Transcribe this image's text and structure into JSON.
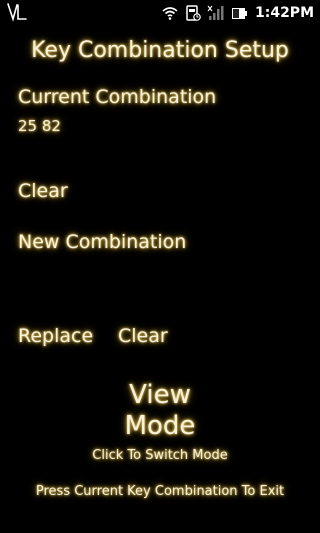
{
  "statusbar": {
    "app_icon": "vl-logo-icon",
    "icons": [
      "wifi-icon",
      "battery-saver-icon",
      "signal-icon",
      "battery-icon"
    ],
    "time": "1:42PM"
  },
  "screen": {
    "title": "Key Combination Setup",
    "current": {
      "label": "Current Combination",
      "value": "25 82",
      "clear_label": "Clear"
    },
    "new": {
      "label": "New Combination",
      "value": "",
      "replace_label": "Replace",
      "clear_label": "Clear"
    },
    "mode": {
      "line1": "View",
      "line2": "Mode",
      "hint": "Click To Switch Mode"
    },
    "footer": "Press Current Key Combination To Exit"
  },
  "colors": {
    "background": "#000000",
    "text": "#f6f2dc",
    "glow": "#c9a63a"
  }
}
